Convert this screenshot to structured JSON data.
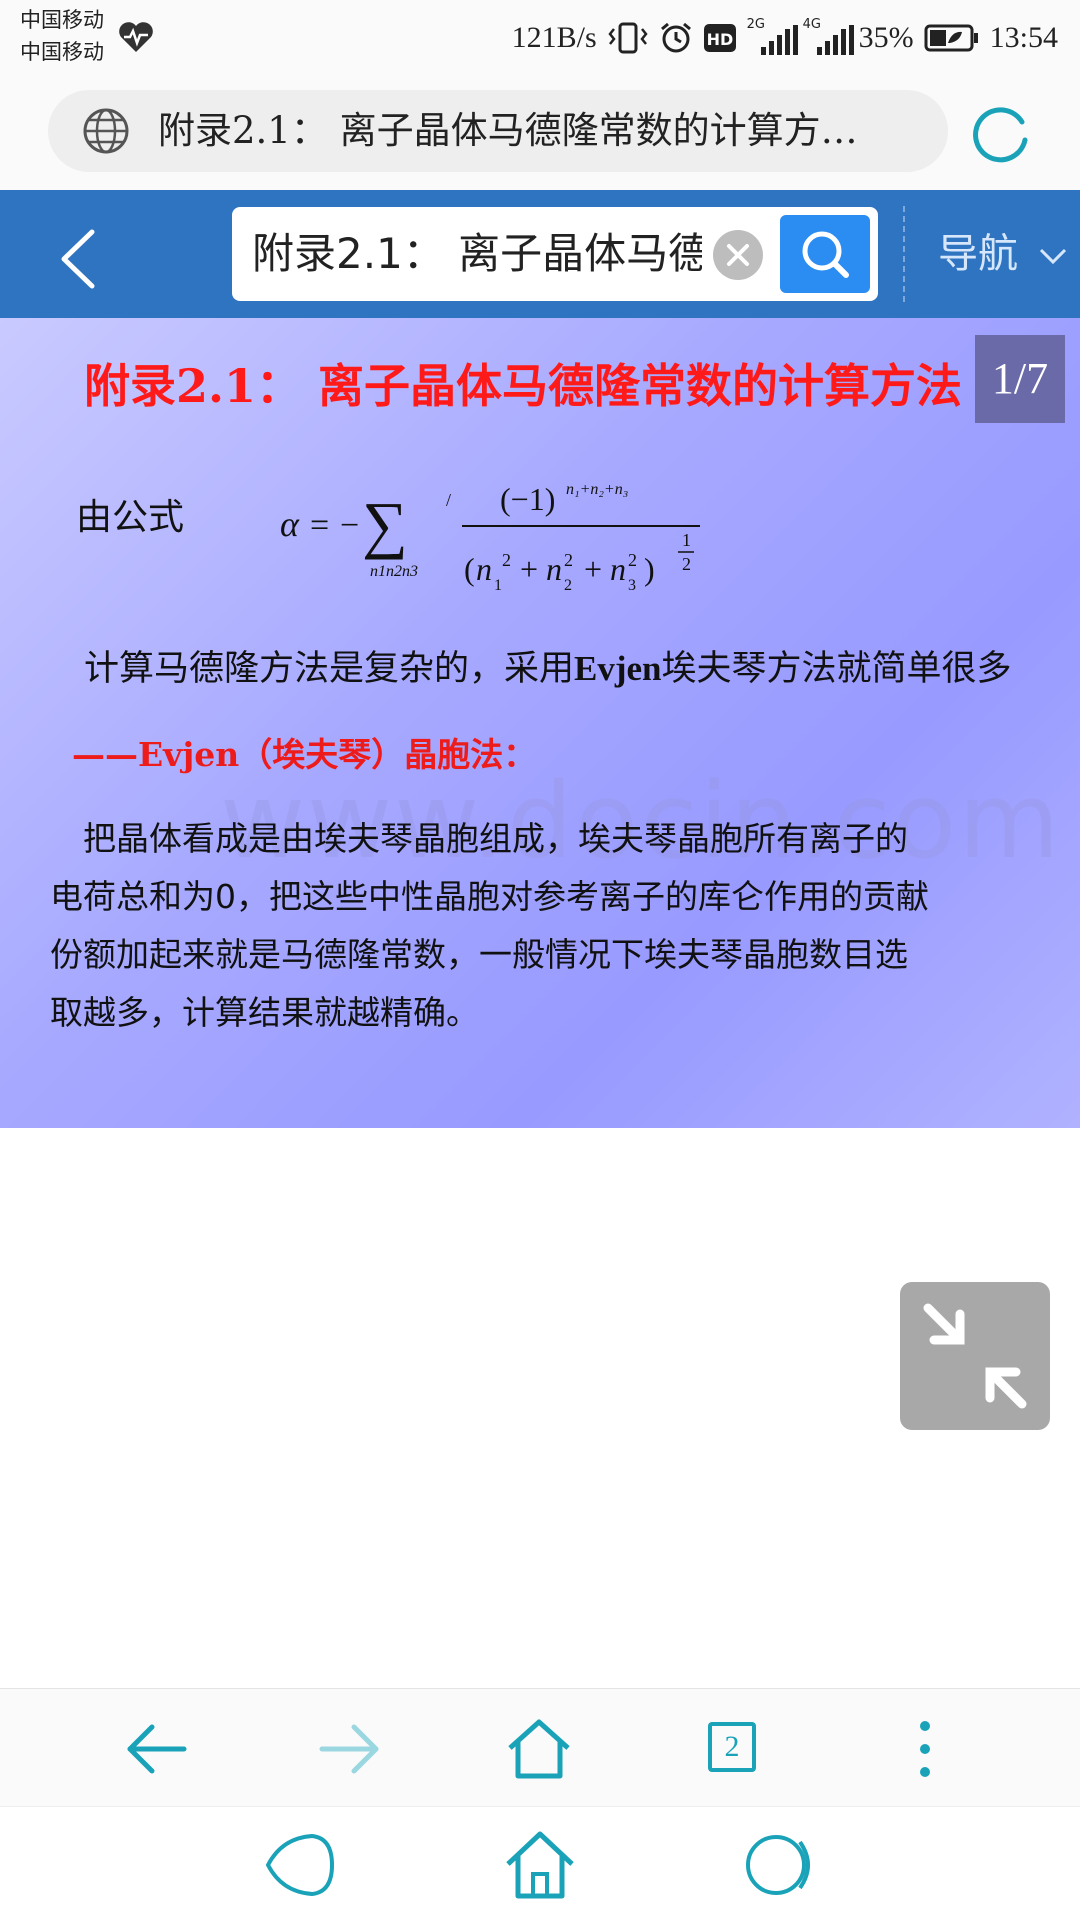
{
  "status_bar": {
    "carrier1": "中国移动",
    "carrier2": "中国移动",
    "net_speed": "121B/s",
    "net2g": "2G",
    "net4g": "4G",
    "battery": "35%",
    "time": "13:54"
  },
  "address_bar": {
    "title": "附录2.1： 离子晶体马德隆常数的计算方…"
  },
  "toolbar": {
    "search_value": "附录2.1： 离子晶体马德",
    "nav_label": "导航"
  },
  "slide": {
    "title": "附录2.1： 离子晶体马德隆常数的计算方法",
    "page_indicator": "1/7",
    "formula_label": "由公式",
    "line1_pre": "计算马德隆方法是复杂的，采用",
    "line1_bold": "Evjen",
    "line1_post": "埃夫琴方法就简单很多",
    "evjen_heading": "——Evjen（埃夫琴）晶胞法：",
    "para_lines": [
      "　把晶体看成是由埃夫琴晶胞组成，埃夫琴晶胞所有离子的",
      "电荷总和为0，把这些中性晶胞对参考离子的库仑作用的贡献",
      "份额加起来就是马德隆常数，一般情况下埃夫琴晶胞数目选",
      "取越多，计算结果就越精确。"
    ],
    "watermark": "www.docin.com"
  },
  "bottom_nav": {
    "tabs_count": "2"
  },
  "colors": {
    "toolbar_blue": "#2f74c0",
    "search_button": "#2b8cf1",
    "title_red": "#ff1a1a",
    "nav_teal": "#1aa3b8"
  }
}
